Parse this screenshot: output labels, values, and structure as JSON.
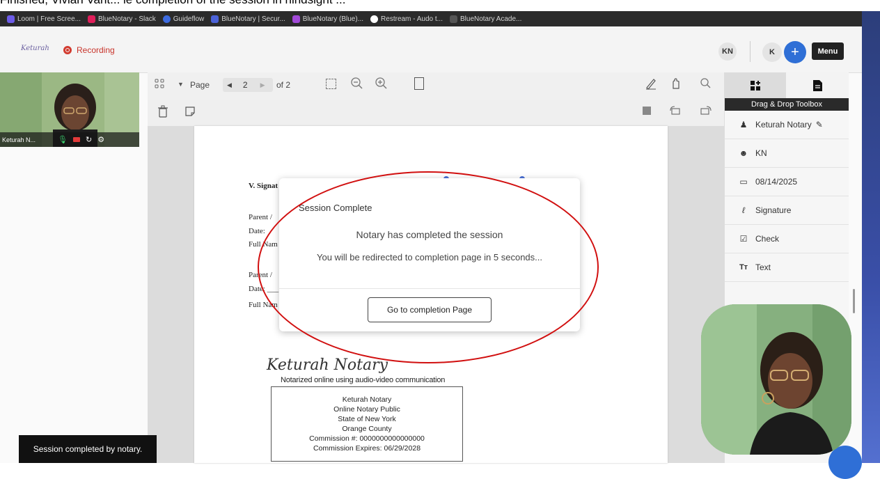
{
  "caption": {
    "text": "Finished, Vivian Vant... le completion of the session in hindsight ..."
  },
  "bookmarks": [
    {
      "label": "Loom | Free Scree...",
      "color": "#6d5ce8"
    },
    {
      "label": "BlueNotary - Slack",
      "color": "#e01e5a"
    },
    {
      "label": "Guideflow",
      "color": "#3d6be0"
    },
    {
      "label": "BlueNotary | Secur...",
      "color": "#4b62d8"
    },
    {
      "label": "BlueNotary (Blue)...",
      "color": "#a24ad8"
    },
    {
      "label": "Restream - Audo t...",
      "color": "#ffffff"
    },
    {
      "label": "BlueNotary Acade...",
      "color": "#555555"
    }
  ],
  "header": {
    "logo_text": "Keturah",
    "recording_label": "Recording",
    "avatar1": "KN",
    "avatar2": "K",
    "add_symbol": "+",
    "menu_label": "Menu"
  },
  "participant": {
    "name": "Keturah N..."
  },
  "pdf_toolbar": {
    "page_label": "Page",
    "current_page": "2",
    "of_label": "of 2"
  },
  "document": {
    "heading": "V. Signat",
    "lines": [
      "Parent /",
      "Date:",
      "Full Nam",
      "Parent /",
      "Date: ___",
      "Full Nam"
    ],
    "signature": "Keturah Notary",
    "notarized_line": "Notarized online using audio-video communication"
  },
  "stamp": {
    "lines": [
      "Keturah Notary",
      "Online Notary Public",
      "State of New York",
      "Orange County",
      "Commission #: 0000000000000000",
      "Commission Expires: 06/29/2028"
    ]
  },
  "toolbox": {
    "title": "Drag & Drop Toolbox",
    "items": [
      {
        "label": "Keturah Notary",
        "icon": "user-icon"
      },
      {
        "label": "KN",
        "icon": "account-circle-icon"
      },
      {
        "label": "08/14/2025",
        "icon": "calendar-icon"
      },
      {
        "label": "Signature",
        "icon": "signature-icon"
      },
      {
        "label": "Check",
        "icon": "checkbox-icon"
      },
      {
        "label": "Text",
        "icon": "text-icon"
      }
    ]
  },
  "modal": {
    "title": "Session Complete",
    "message": "Notary has completed the session",
    "redirect": "You will be redirected to completion page in 5 seconds...",
    "button": "Go to completion Page"
  },
  "toast": {
    "text": "Session completed by notary."
  },
  "colors": {
    "accent": "#2f6fd6",
    "recording": "#c8342b",
    "annotation": "#d10f0f"
  }
}
